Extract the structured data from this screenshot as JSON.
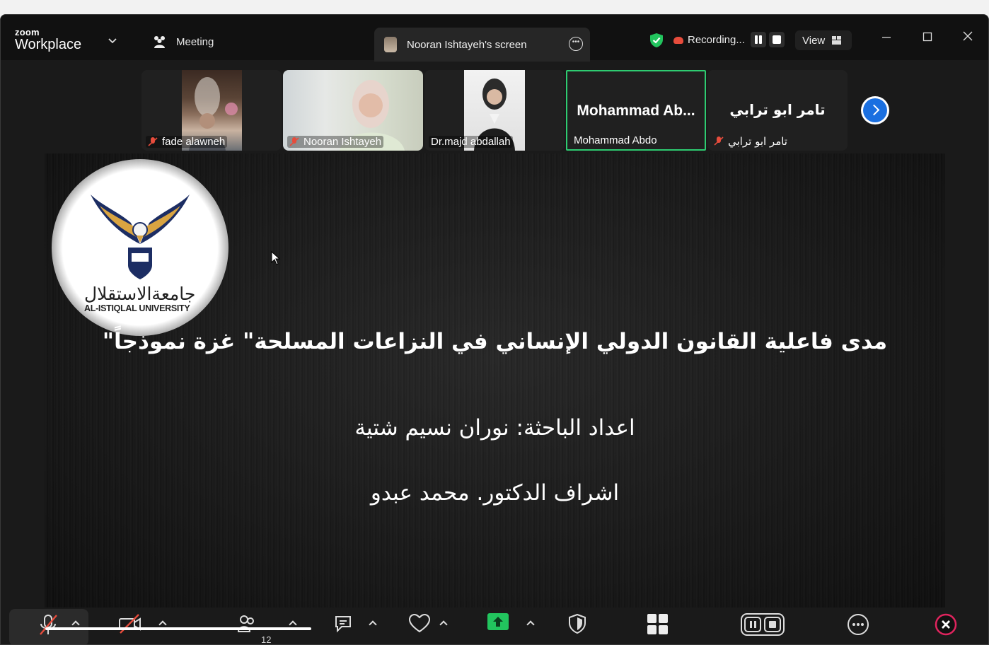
{
  "app": {
    "brand_top": "zoom",
    "brand_bottom": "Workplace"
  },
  "header": {
    "meeting_label": "Meeting",
    "screen_tab_label": "Nooran Ishtayeh's screen",
    "recording_label": "Recording...",
    "view_label": "View"
  },
  "participants": [
    {
      "name": "fade alawneh",
      "muted": true
    },
    {
      "name": "Nooran Ishtayeh",
      "muted": true
    },
    {
      "name": "Dr.majd abdallah",
      "muted": false
    },
    {
      "name": "Mohammad Abdo",
      "display": "Mohammad  Ab...",
      "muted": false,
      "active": true
    },
    {
      "name": "تامر ابو ترابي",
      "display": "تامر ابو ترابي",
      "muted": true
    }
  ],
  "slide": {
    "logo_arabic": "جامعةالاستقلال",
    "logo_english": "AL-ISTIQLAL UNIVERSITY",
    "title": "مدى فاعلية القانون الدولي الإنساني في النزاعات المسلحة\" غزة نموذجاً\"",
    "author_line": "اعداد الباحثة: نوران نسيم شتية",
    "supervisor_line": "اشراف الدكتور. محمد عبدو"
  },
  "toolbar": {
    "participants_count": "12"
  },
  "colors": {
    "active_border": "#2ecc71",
    "next_button": "#1a6fe0",
    "share_button": "#22c55e",
    "end_button": "#e0245e",
    "mute_red": "#e74c3c"
  }
}
